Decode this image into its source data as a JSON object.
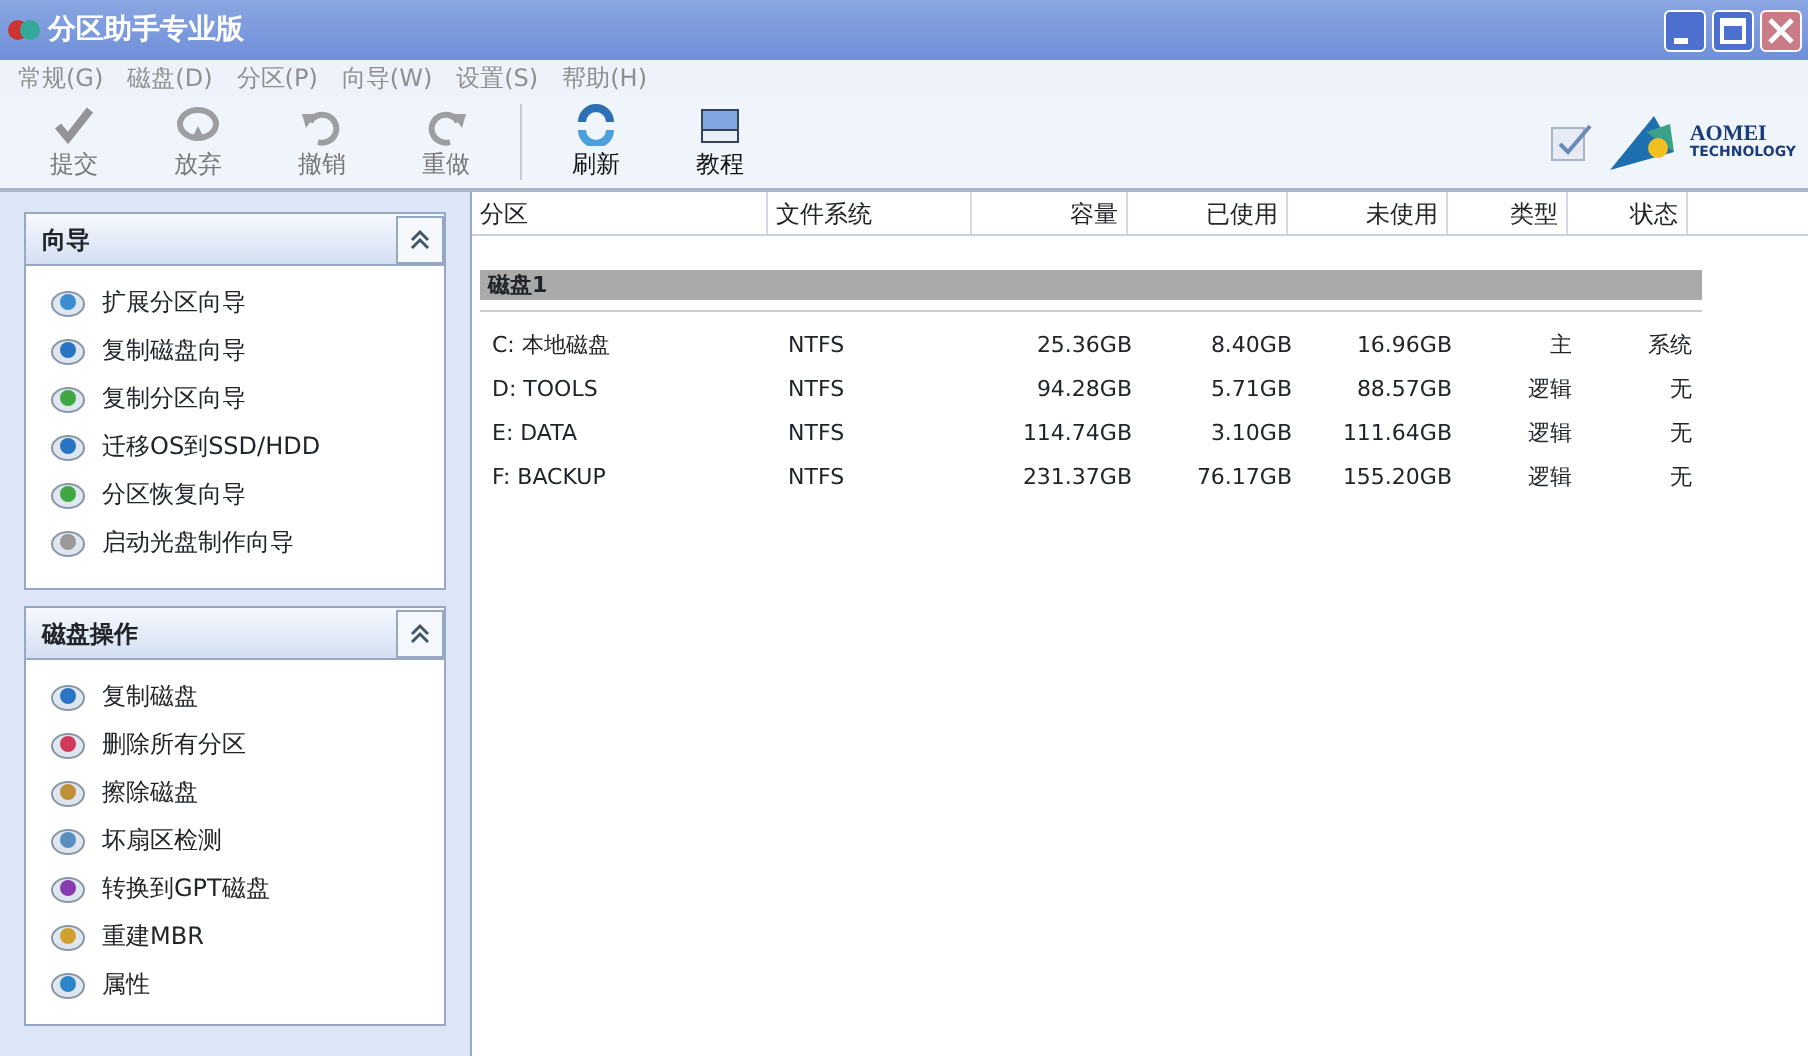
{
  "window": {
    "title": "分区助手专业版"
  },
  "menu": [
    {
      "label": "常规(G)",
      "disabled": true
    },
    {
      "label": "磁盘(D)",
      "disabled": true
    },
    {
      "label": "分区(P)",
      "disabled": true
    },
    {
      "label": "向导(W)",
      "disabled": true
    },
    {
      "label": "设置(S)",
      "disabled": true
    },
    {
      "label": "帮助(H)",
      "disabled": true
    }
  ],
  "toolbar": [
    {
      "label": "提交",
      "kind": "check",
      "disabled": true
    },
    {
      "label": "放弃",
      "kind": "discard",
      "disabled": true
    },
    {
      "label": "撤销",
      "kind": "undo",
      "disabled": true
    },
    {
      "label": "重做",
      "kind": "redo",
      "disabled": true
    },
    {
      "label": "刷新",
      "kind": "refresh",
      "disabled": false
    },
    {
      "label": "教程",
      "kind": "book",
      "disabled": false
    }
  ],
  "logo": {
    "name": "AOMEI",
    "tagline": "TECHNOLOGY"
  },
  "sidebar": [
    {
      "title": "向导",
      "expanded": true,
      "items": [
        "扩展分区向导",
        "复制磁盘向导",
        "复制分区向导",
        "迁移OS到SSD/HDD",
        "分区恢复向导",
        "启动光盘制作向导"
      ]
    },
    {
      "title": "磁盘操作",
      "expanded": true,
      "items": [
        "复制磁盘",
        "删除所有分区",
        "擦除磁盘",
        "坏扇区检测",
        "转换到GPT磁盘",
        "重建MBR",
        "属性"
      ]
    }
  ],
  "table": {
    "columns": [
      "分区",
      "文件系统",
      "容量",
      "已使用",
      "未使用",
      "类型",
      "状态"
    ],
    "disks": [
      {
        "name": "磁盘1",
        "rows": [
          [
            "C: 本地磁盘",
            "NTFS",
            "25.36GB",
            "8.40GB",
            "16.96GB",
            "主",
            "系统"
          ],
          [
            "D: TOOLS",
            "NTFS",
            "94.28GB",
            "5.71GB",
            "88.57GB",
            "逻辑",
            "无"
          ],
          [
            "E: DATA",
            "NTFS",
            "114.74GB",
            "3.10GB",
            "111.64GB",
            "逻辑",
            "无"
          ],
          [
            "F: BACKUP",
            "NTFS",
            "231.37GB",
            "76.17GB",
            "155.20GB",
            "逻辑",
            "无"
          ]
        ]
      }
    ]
  }
}
